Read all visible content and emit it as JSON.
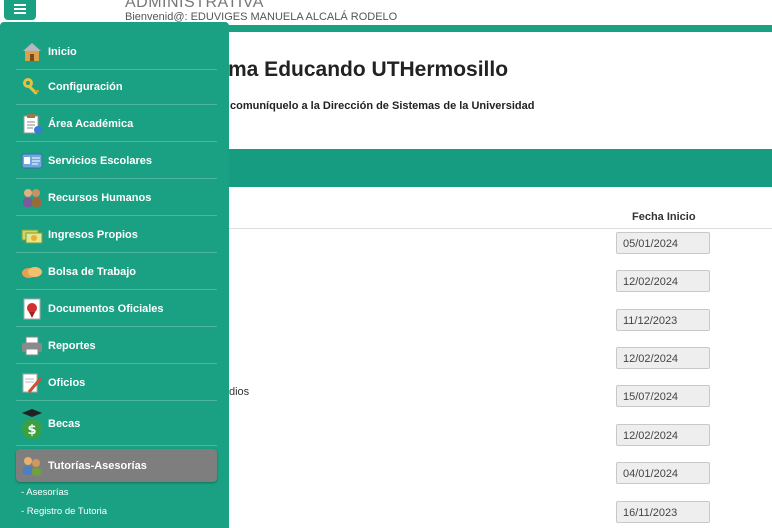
{
  "header": {
    "title": "ADMINISTRATIVA",
    "welcome": "Bienvenid@: EDUVIGES MANUELA ALCALÁ RODELO"
  },
  "main": {
    "title": "ma Educando UTHermosillo",
    "notice": "comuníquelo a la Dirección de Sistemas de la Universidad",
    "column_header": "Fecha Inicio",
    "row_fragment": "dios",
    "dates": [
      "05/01/2024",
      "12/02/2024",
      "11/12/2023",
      "12/02/2024",
      "15/07/2024",
      "12/02/2024",
      "04/01/2024",
      "16/11/2023"
    ]
  },
  "sidebar": {
    "items": [
      {
        "label": "Inicio",
        "icon": "home-icon"
      },
      {
        "label": "Configuración",
        "icon": "keys-icon"
      },
      {
        "label": "Área Académica",
        "icon": "clipboard-icon"
      },
      {
        "label": "Servicios Escolares",
        "icon": "id-card-icon"
      },
      {
        "label": "Recursos Humanos",
        "icon": "people-icon"
      },
      {
        "label": "Ingresos Propios",
        "icon": "money-icon"
      },
      {
        "label": "Bolsa de Trabajo",
        "icon": "handshake-icon"
      },
      {
        "label": "Documentos Oficiales",
        "icon": "certificate-icon"
      },
      {
        "label": "Reportes",
        "icon": "printer-icon"
      },
      {
        "label": "Oficios",
        "icon": "document-pen-icon"
      },
      {
        "label": "Becas",
        "icon": "graduation-money-icon"
      },
      {
        "label": "Tutorías-Asesorías",
        "icon": "tutoring-icon"
      }
    ],
    "subitems": [
      "- Asesorías",
      "- Registro de Tutoria"
    ]
  },
  "colors": {
    "brand_green": "#1aa083",
    "active_item": "#7e7e7e",
    "date_field": "#eeeeee"
  }
}
